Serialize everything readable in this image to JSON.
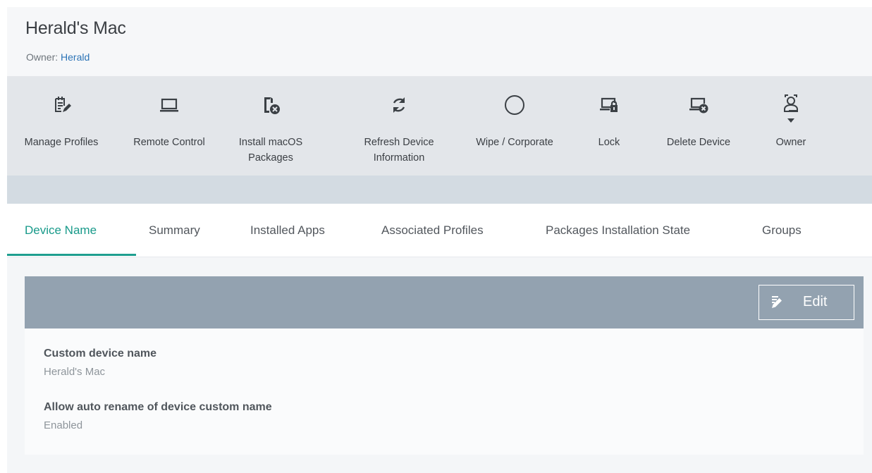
{
  "device": {
    "title": "Herald's Mac",
    "owner_prefix": "Owner: ",
    "owner_name": "Herald"
  },
  "toolbar": {
    "items": [
      {
        "label": "Manage Profiles",
        "icon": "manage-profiles-icon"
      },
      {
        "label": "Remote Control",
        "icon": "laptop-icon"
      },
      {
        "label": "Install macOS\nPackages",
        "icon": "install-packages-icon"
      },
      {
        "label": "Refresh Device\nInformation",
        "icon": "refresh-icon"
      },
      {
        "label": "Wipe / Corporate",
        "icon": "circle-icon"
      },
      {
        "label": "Lock",
        "icon": "lock-device-icon"
      },
      {
        "label": "Delete Device",
        "icon": "delete-device-icon"
      },
      {
        "label": "Owner",
        "icon": "owner-icon"
      }
    ]
  },
  "tabs": [
    {
      "label": "Device Name",
      "active": true
    },
    {
      "label": "Summary"
    },
    {
      "label": "Installed Apps"
    },
    {
      "label": "Associated Profiles"
    },
    {
      "label": "Packages Installation State"
    },
    {
      "label": "Groups"
    }
  ],
  "panel": {
    "edit_label": "Edit",
    "fields": [
      {
        "label": "Custom device name",
        "value": "Herald's Mac"
      },
      {
        "label": "Allow auto rename of device custom name",
        "value": "Enabled"
      }
    ]
  },
  "colors": {
    "accent": "#1e9e8f",
    "link": "#2b73b6",
    "panel_header": "#93a2b0",
    "toolbar_bg": "#e3e6ea"
  }
}
